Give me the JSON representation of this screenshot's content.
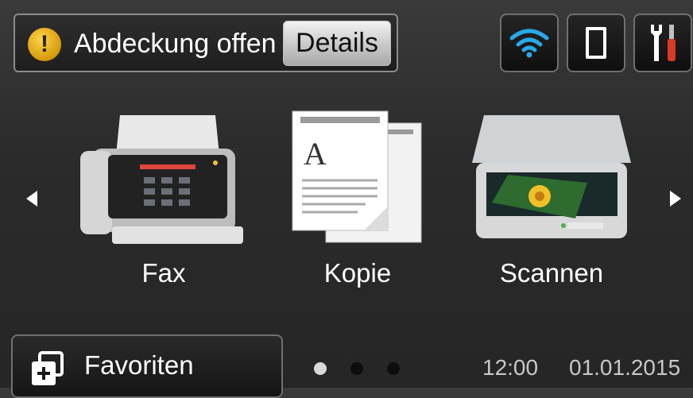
{
  "status": {
    "message": "Abdeckung offen",
    "details_label": "Details"
  },
  "icons": {
    "warning": "warning-icon",
    "wifi": "wifi-icon",
    "tray": "paper-tray-icon",
    "tools": "settings-tools-icon"
  },
  "functions": [
    {
      "label": "Fax",
      "icon": "fax-icon"
    },
    {
      "label": "Kopie",
      "icon": "copy-icon"
    },
    {
      "label": "Scannen",
      "icon": "scanner-icon"
    }
  ],
  "favorites": {
    "label": "Favoriten",
    "icon": "favorites-icon"
  },
  "pager": {
    "current_page": 1,
    "total_pages": 3
  },
  "clock": {
    "time": "12:00",
    "date": "01.01.2015"
  },
  "colors": {
    "warning": "#e0a412",
    "wifi": "#29a8e8",
    "screwdriver": "#d83a2a"
  }
}
